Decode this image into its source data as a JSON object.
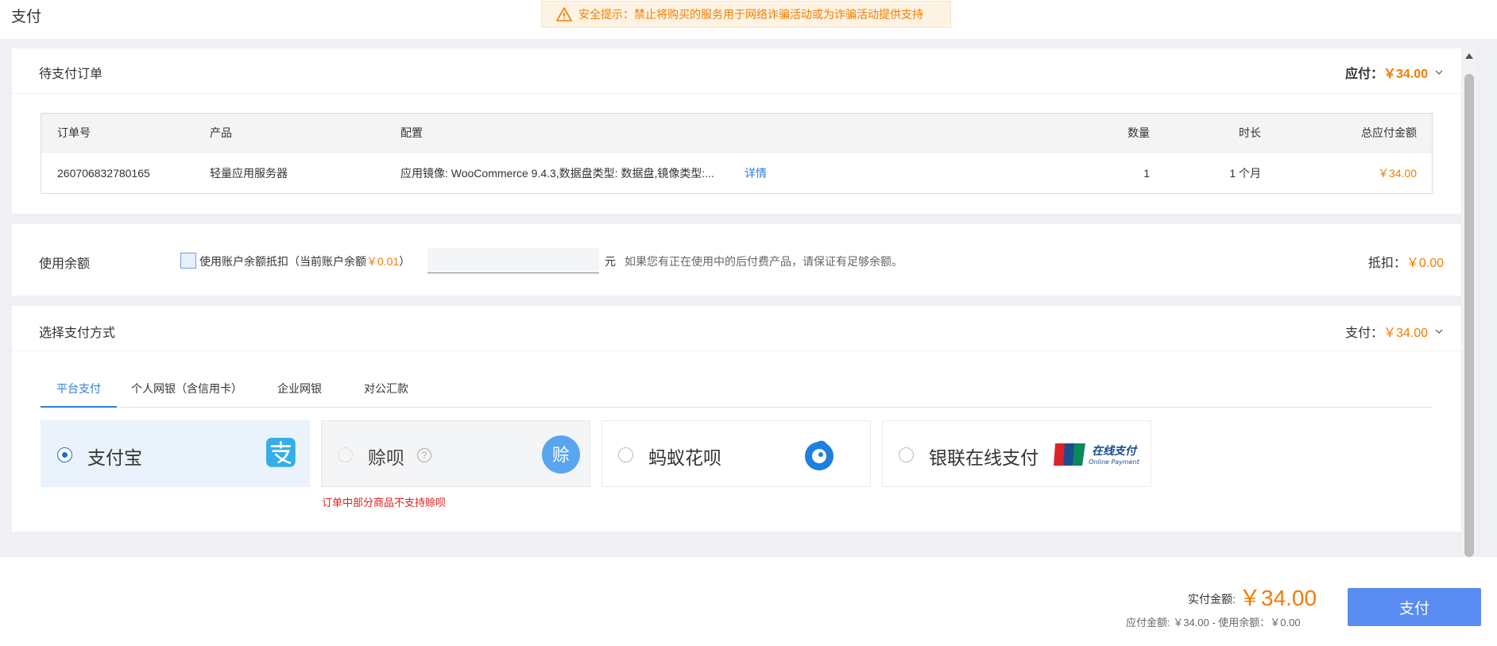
{
  "page_title": "支付",
  "warning": "安全提示：禁止将购买的服务用于网络诈骗活动或为诈骗活动提供支持",
  "order": {
    "title": "待支付订单",
    "due_label": "应付：",
    "due_amount": "￥34.00",
    "headers": [
      "订单号",
      "产品",
      "配置",
      "数量",
      "时长",
      "总应付金额"
    ],
    "row": {
      "order_no": "260706832780165",
      "product": "轻量应用服务器",
      "config": "应用镜像: WooCommerce 9.4.3,数据盘类型: 数据盘,镜像类型:...",
      "details_link": "详情",
      "qty": "1",
      "duration": "1 个月",
      "total": "￥34.00"
    }
  },
  "balance": {
    "title": "使用余额",
    "checkbox_text": "使用账户余额抵扣（当前账户余额",
    "balance_value": "￥0.01",
    "checkbox_close": "）",
    "input_value": "",
    "unit": "元",
    "hint": "如果您有正在使用中的后付费产品，请保证有足够余额。",
    "deduct_label": "抵扣：",
    "deduct_amount": "￥0.00"
  },
  "payment": {
    "title": "选择支付方式",
    "pay_label": "支付：",
    "pay_amount": "￥34.00",
    "tabs": [
      "平台支付",
      "个人网银（含信用卡）",
      "企业网银",
      "对公汇款"
    ],
    "active_tab": "平台支付",
    "methods": [
      "支付宝",
      "赊呗",
      "蚂蚁花呗",
      "银联在线支付"
    ],
    "selected_method": "支付宝",
    "shebei_logo_text": "赊",
    "unionpay_logo_text": "在线支付",
    "unionpay_logo_sub": "Online Payment",
    "huabei_note": "订单中部分商品不支持赊呗"
  },
  "footer": {
    "actual_label": "实付金额:",
    "actual_amount": "￥34.00",
    "breakdown": "应付金额: ￥34.00 - 使用余额：￥0.00",
    "pay_button": "支付"
  },
  "colors": {
    "accent_orange": "#f27c00",
    "primary_blue": "#5a8cf2",
    "tab_blue": "#2f7bd8",
    "error_red": "#e0201a"
  }
}
